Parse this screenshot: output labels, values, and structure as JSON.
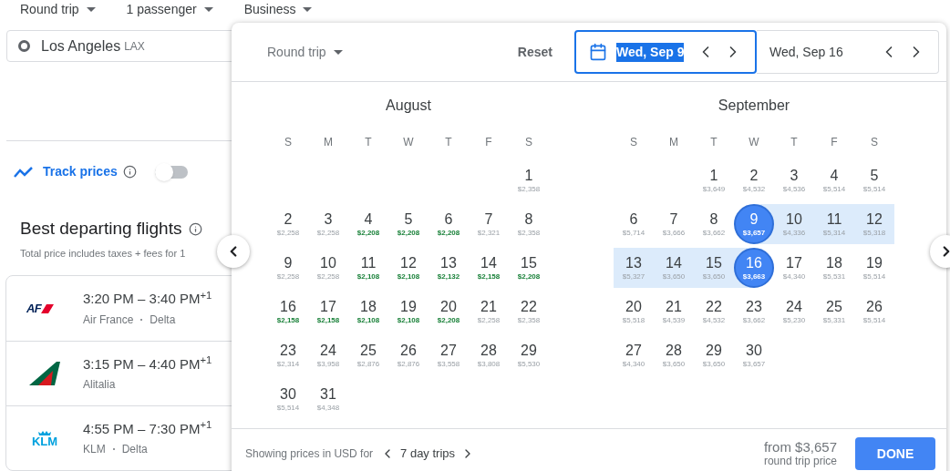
{
  "top_options": [
    {
      "label": "Round trip"
    },
    {
      "label": "1 passenger"
    },
    {
      "label": "Business"
    }
  ],
  "origin": {
    "city": "Los Angeles",
    "code": "LAX"
  },
  "track_prices": {
    "label": "Track prices",
    "on": false
  },
  "results": {
    "title": "Best departing flights",
    "subtitle": "Total price includes taxes + fees for 1",
    "flights": [
      {
        "kind": "af",
        "logo_text": "AF",
        "times": "3:20 PM – 3:40 PM$^{+1}$",
        "airlines": [
          "Air France",
          "Delta"
        ]
      },
      {
        "kind": "alitalia",
        "times": "3:15 PM – 4:40 PM$^{+1}$",
        "airlines": [
          "Alitalia"
        ]
      },
      {
        "kind": "klm",
        "logo_text": "KLM",
        "times": "4:55 PM – 7:30 PM$^{+1}$",
        "airlines": [
          "KLM",
          "Delta"
        ]
      }
    ]
  },
  "date_picker": {
    "trip_type": "Round trip",
    "reset": "Reset",
    "dates": [
      {
        "value": "Wed, Sep 9",
        "focused": true
      },
      {
        "value": "Wed, Sep 16",
        "focused": false
      }
    ],
    "months": [
      {
        "name": "August",
        "weekdays": [
          "S",
          "M",
          "T",
          "W",
          "T",
          "F",
          "S"
        ],
        "weeks": [
          [
            {
              "day": "1",
              "price": "$2,358",
              "low": false,
              "selected": false,
              "in_range": false
            }
          ],
          [
            {
              "day": "2",
              "price": "$2,258",
              "low": false,
              "selected": false,
              "in_range": false
            },
            {
              "day": "3",
              "price": "$2,258",
              "low": false,
              "selected": false,
              "in_range": false
            },
            {
              "day": "4",
              "price": "$2,208",
              "low": true,
              "selected": false,
              "in_range": false
            },
            {
              "day": "5",
              "price": "$2,208",
              "low": true,
              "selected": false,
              "in_range": false
            },
            {
              "day": "6",
              "price": "$2,208",
              "low": true,
              "selected": false,
              "in_range": false
            },
            {
              "day": "7",
              "price": "$2,321",
              "low": false,
              "selected": false,
              "in_range": false
            },
            {
              "day": "8",
              "price": "$2,358",
              "low": false,
              "selected": false,
              "in_range": false
            }
          ],
          [
            {
              "day": "9",
              "price": "$2,258",
              "low": false,
              "selected": false,
              "in_range": false
            },
            {
              "day": "10",
              "price": "$2,258",
              "low": false,
              "selected": false,
              "in_range": false
            },
            {
              "day": "11",
              "price": "$2,108",
              "low": true,
              "selected": false,
              "in_range": false
            },
            {
              "day": "12",
              "price": "$2,108",
              "low": true,
              "selected": false,
              "in_range": false
            },
            {
              "day": "13",
              "price": "$2,132",
              "low": true,
              "selected": false,
              "in_range": false
            },
            {
              "day": "14",
              "price": "$2,158",
              "low": true,
              "selected": false,
              "in_range": false
            },
            {
              "day": "15",
              "price": "$2,208",
              "low": true,
              "selected": false,
              "in_range": false
            }
          ],
          [
            {
              "day": "16",
              "price": "$2,158",
              "low": true,
              "selected": false,
              "in_range": false
            },
            {
              "day": "17",
              "price": "$2,158",
              "low": true,
              "selected": false,
              "in_range": false
            },
            {
              "day": "18",
              "price": "$2,108",
              "low": true,
              "selected": false,
              "in_range": false
            },
            {
              "day": "19",
              "price": "$2,108",
              "low": true,
              "selected": false,
              "in_range": false
            },
            {
              "day": "20",
              "price": "$2,208",
              "low": true,
              "selected": false,
              "in_range": false
            },
            {
              "day": "21",
              "price": "$2,258",
              "low": false,
              "selected": false,
              "in_range": false
            },
            {
              "day": "22",
              "price": "$2,358",
              "low": false,
              "selected": false,
              "in_range": false
            }
          ],
          [
            {
              "day": "23",
              "price": "$2,314",
              "low": false,
              "selected": false,
              "in_range": false
            },
            {
              "day": "24",
              "price": "$3,958",
              "low": false,
              "selected": false,
              "in_range": false
            },
            {
              "day": "25",
              "price": "$2,876",
              "low": false,
              "selected": false,
              "in_range": false
            },
            {
              "day": "26",
              "price": "$2,876",
              "low": false,
              "selected": false,
              "in_range": false
            },
            {
              "day": "27",
              "price": "$3,558",
              "low": false,
              "selected": false,
              "in_range": false
            },
            {
              "day": "28",
              "price": "$3,808",
              "low": false,
              "selected": false,
              "in_range": false
            },
            {
              "day": "29",
              "price": "$5,530",
              "low": false,
              "selected": false,
              "in_range": false
            }
          ],
          [
            {
              "day": "30",
              "price": "$5,514",
              "low": false,
              "selected": false,
              "in_range": false
            },
            {
              "day": "31",
              "price": "$4,348",
              "low": false,
              "selected": false,
              "in_range": false
            }
          ]
        ]
      },
      {
        "name": "September",
        "weekdays": [
          "S",
          "M",
          "T",
          "W",
          "T",
          "F",
          "S"
        ],
        "weeks": [
          [
            {
              "day": "1",
              "price": "$3,649",
              "low": false,
              "selected": false,
              "in_range": false
            },
            {
              "day": "2",
              "price": "$4,532",
              "low": false,
              "selected": false,
              "in_range": false
            },
            {
              "day": "3",
              "price": "$4,536",
              "low": false,
              "selected": false,
              "in_range": false
            },
            {
              "day": "4",
              "price": "$5,514",
              "low": false,
              "selected": false,
              "in_range": false
            },
            {
              "day": "5",
              "price": "$5,514",
              "low": false,
              "selected": false,
              "in_range": false
            }
          ],
          [
            {
              "day": "6",
              "price": "$5,714",
              "low": false,
              "selected": false,
              "in_range": false
            },
            {
              "day": "7",
              "price": "$3,666",
              "low": false,
              "selected": false,
              "in_range": false
            },
            {
              "day": "8",
              "price": "$3,662",
              "low": false,
              "selected": false,
              "in_range": false
            },
            {
              "day": "9",
              "price": "$3,657",
              "selected": true,
              "in_range": true
            },
            {
              "day": "10",
              "price": "$4,336",
              "low": false,
              "selected": false,
              "in_range": true
            },
            {
              "day": "11",
              "price": "$5,314",
              "low": false,
              "selected": false,
              "in_range": true
            },
            {
              "day": "12",
              "price": "$5,318",
              "low": false,
              "selected": false,
              "in_range": true
            }
          ],
          [
            {
              "day": "13",
              "price": "$5,327",
              "low": false,
              "selected": false,
              "in_range": true
            },
            {
              "day": "14",
              "price": "$3,650",
              "low": false,
              "selected": false,
              "in_range": true
            },
            {
              "day": "15",
              "price": "$3,650",
              "low": false,
              "selected": false,
              "in_range": true
            },
            {
              "day": "16",
              "price": "$3,663",
              "selected": true,
              "in_range": true
            },
            {
              "day": "17",
              "price": "$4,340",
              "low": false,
              "selected": false,
              "in_range": false
            },
            {
              "day": "18",
              "price": "$5,531",
              "low": false,
              "selected": false,
              "in_range": false
            },
            {
              "day": "19",
              "price": "$5,514",
              "low": false,
              "selected": false,
              "in_range": false
            }
          ],
          [
            {
              "day": "20",
              "price": "$5,518",
              "low": false,
              "selected": false,
              "in_range": false
            },
            {
              "day": "21",
              "price": "$4,539",
              "low": false,
              "selected": false,
              "in_range": false
            },
            {
              "day": "22",
              "price": "$4,532",
              "low": false,
              "selected": false,
              "in_range": false
            },
            {
              "day": "23",
              "price": "$3,662",
              "low": false,
              "selected": false,
              "in_range": false
            },
            {
              "day": "24",
              "price": "$5,230",
              "low": false,
              "selected": false,
              "in_range": false
            },
            {
              "day": "25",
              "price": "$5,331",
              "low": false,
              "selected": false,
              "in_range": false
            },
            {
              "day": "26",
              "price": "$5,514",
              "low": false,
              "selected": false,
              "in_range": false
            }
          ],
          [
            {
              "day": "27",
              "price": "$4,340",
              "low": false,
              "selected": false,
              "in_range": false
            },
            {
              "day": "28",
              "price": "$3,650",
              "low": false,
              "selected": false,
              "in_range": false
            },
            {
              "day": "29",
              "price": "$3,650",
              "low": false,
              "selected": false,
              "in_range": false
            },
            {
              "day": "30",
              "price": "$3,657",
              "low": false,
              "selected": false,
              "in_range": false
            }
          ]
        ]
      }
    ],
    "footer": {
      "note": "Showing prices in USD for",
      "trip_length": "7 day trips",
      "from_price": "from $3,657",
      "price_caption": "round trip price",
      "done": "DONE"
    }
  }
}
